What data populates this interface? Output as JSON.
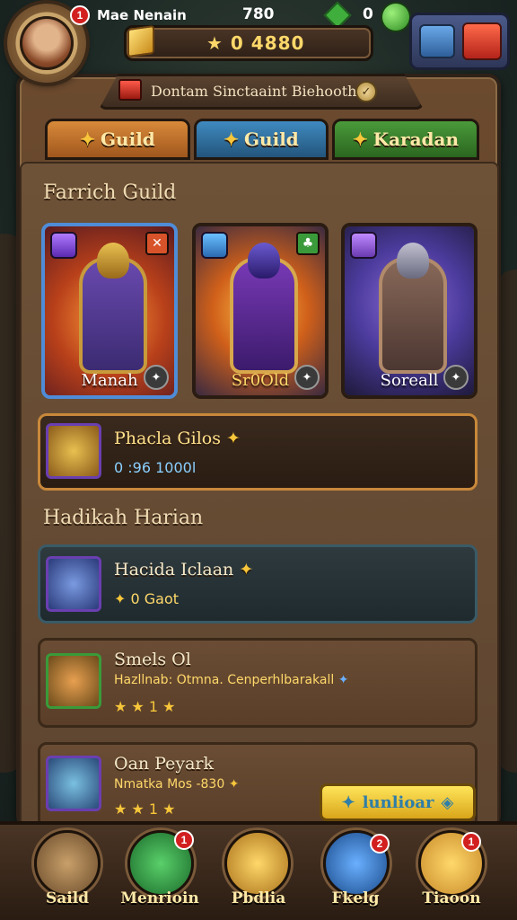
{
  "topbar": {
    "player_name": "Mae Nenain",
    "player_level": "780",
    "gem_count": "0",
    "gold_value": "★ 0  4880",
    "avatar_badge": "1"
  },
  "notice": {
    "text": "Dontam Sinctaaint Biehooth"
  },
  "tabs": [
    {
      "label": "Guild",
      "color": "#d88a3a"
    },
    {
      "label": "Guild",
      "color": "#3f8ac0"
    },
    {
      "label": "Karadan",
      "color": "#4a9a3a"
    }
  ],
  "guild_section": {
    "title": "Farrich Guild",
    "heroes": [
      {
        "name": "Manah",
        "element_icon": "purple-gem-icon",
        "class_icon": "crossed-swords-icon"
      },
      {
        "name": "Sr0Old",
        "element_icon": "blue-gem-icon",
        "class_icon": "tree-icon"
      },
      {
        "name": "Soreall",
        "element_icon": "purple-hammer-icon",
        "class_icon": ""
      }
    ],
    "featured": {
      "title": "Phacla Gilos",
      "sub": "0 :96  1000l"
    }
  },
  "daily_section": {
    "title": "Hadikah Harian",
    "rows": [
      {
        "title": "Hacida Iclaan",
        "sub": "0   Gaot"
      },
      {
        "title": "Smels Ol",
        "sub": "Hazllnab: Otmna. Cenperhlbarakall",
        "stars": "★ ★ 1 ★"
      },
      {
        "title": "Oan Peyark",
        "sub": "Nmatka Mos -830",
        "stars": "★ ★ 1 ★"
      }
    ],
    "action_label": "lunlioar"
  },
  "bottom_nav": [
    {
      "label": "Saild",
      "badge": ""
    },
    {
      "label": "Menrioin",
      "badge": "1"
    },
    {
      "label": "Pbdlia",
      "badge": ""
    },
    {
      "label": "Fkelg",
      "badge": "2"
    },
    {
      "label": "Tiaoon",
      "badge": "1"
    }
  ]
}
